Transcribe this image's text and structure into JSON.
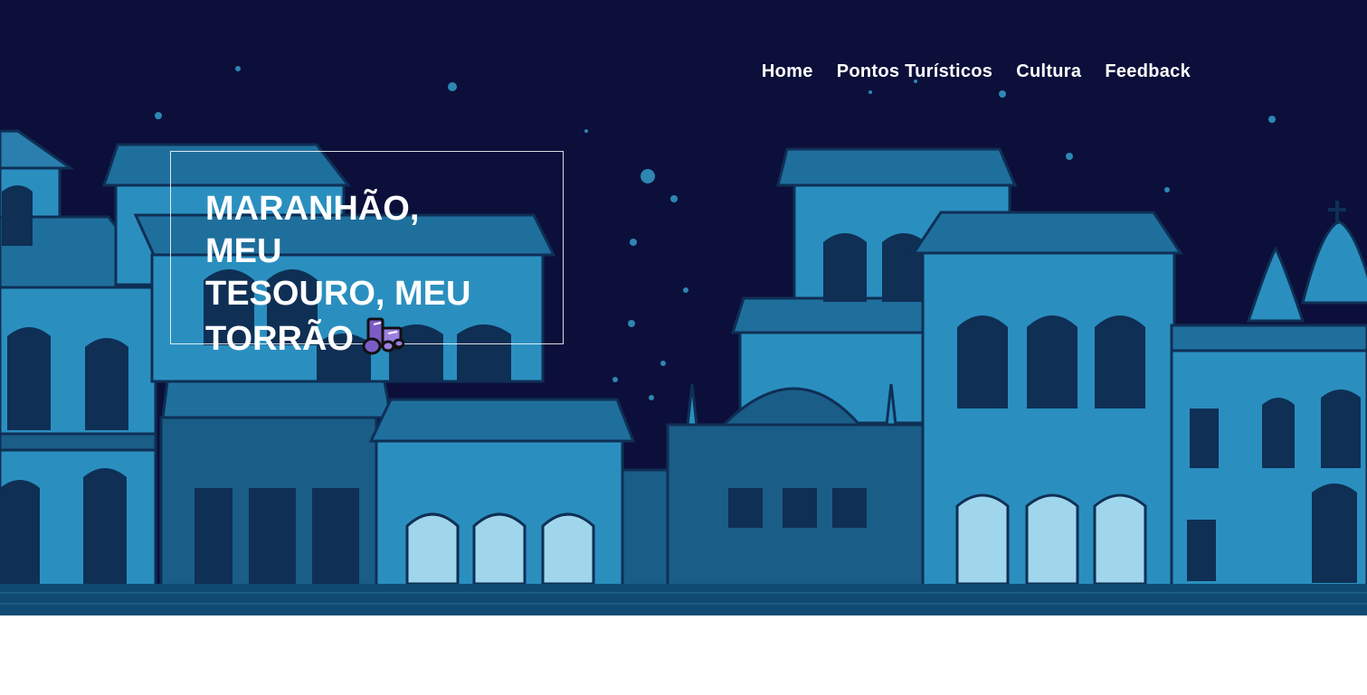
{
  "nav": {
    "items": [
      {
        "label": "Home"
      },
      {
        "label": "Pontos Turísticos"
      },
      {
        "label": "Cultura"
      },
      {
        "label": "Feedback"
      }
    ]
  },
  "hero": {
    "title_line1": "MARANHÃO, MEU",
    "title_line2": "TESOURO, MEU",
    "title_line3": "TORRÃO",
    "icon": "music-notes-icon"
  },
  "colors": {
    "night_sky": "#0b0f3a",
    "building_light": "#2a8fbf",
    "building_dark": "#1a5d87",
    "outline": "#0f2f55",
    "icon_purple": "#7b5cc4",
    "white": "#ffffff"
  }
}
